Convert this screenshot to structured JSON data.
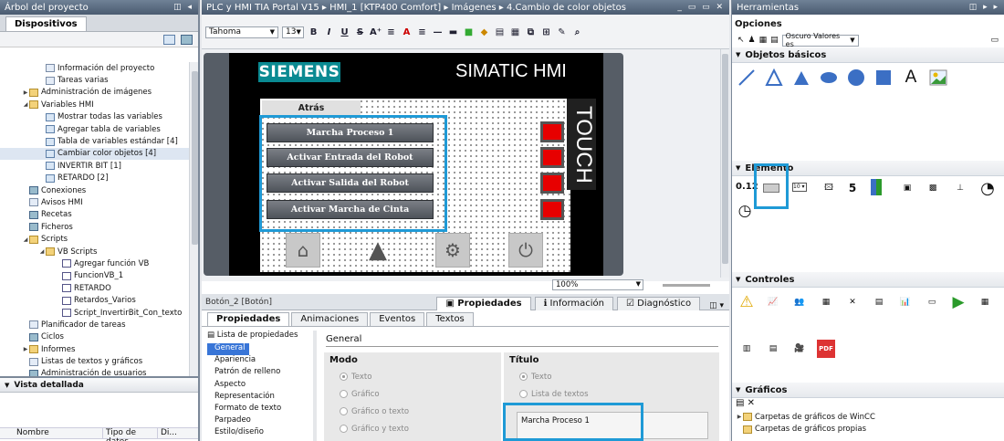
{
  "left": {
    "header": "Árbol del proyecto",
    "tab": "Dispositivos",
    "tree": [
      {
        "label": "Información del proyecto",
        "indent": 52,
        "icon": "doc"
      },
      {
        "label": "Tareas varias",
        "indent": 52,
        "icon": "doc"
      },
      {
        "label": "Administración de imágenes",
        "indent": 34,
        "icon": "folder",
        "arrow": "▶"
      },
      {
        "label": "Variables HMI",
        "indent": 34,
        "icon": "folder",
        "arrow": "◢"
      },
      {
        "label": "Mostrar todas las variables",
        "indent": 52,
        "icon": "tag"
      },
      {
        "label": "Agregar tabla de variables",
        "indent": 52,
        "icon": "tag"
      },
      {
        "label": "Tabla de variables estándar [4]",
        "indent": 52,
        "icon": "tag"
      },
      {
        "label": "Cambiar color objetos [4]",
        "indent": 52,
        "icon": "tag",
        "sel": true
      },
      {
        "label": "INVERTIR BIT [1]",
        "indent": 52,
        "icon": "tag"
      },
      {
        "label": "RETARDO [2]",
        "indent": 52,
        "icon": "tag"
      },
      {
        "label": "Conexiones",
        "indent": 34,
        "icon": "gear"
      },
      {
        "label": "Avisos HMI",
        "indent": 34,
        "icon": "doc"
      },
      {
        "label": "Recetas",
        "indent": 34,
        "icon": "gear"
      },
      {
        "label": "Ficheros",
        "indent": 34,
        "icon": "gear"
      },
      {
        "label": "Scripts",
        "indent": 34,
        "icon": "folder",
        "arrow": "◢"
      },
      {
        "label": "VB Scripts",
        "indent": 52,
        "icon": "folder",
        "arrow": "◢"
      },
      {
        "label": "Agregar función VB",
        "indent": 70,
        "icon": "script"
      },
      {
        "label": "FuncionVB_1",
        "indent": 70,
        "icon": "script"
      },
      {
        "label": "RETARDO",
        "indent": 70,
        "icon": "script"
      },
      {
        "label": "Retardos_Varios",
        "indent": 70,
        "icon": "script"
      },
      {
        "label": "Script_InvertirBit_Con_texto",
        "indent": 70,
        "icon": "script"
      },
      {
        "label": "Planificador de tareas",
        "indent": 34,
        "icon": "doc"
      },
      {
        "label": "Ciclos",
        "indent": 34,
        "icon": "gear"
      },
      {
        "label": "Informes",
        "indent": 34,
        "icon": "folder",
        "arrow": "▶"
      },
      {
        "label": "Listas de textos y gráficos",
        "indent": 34,
        "icon": "doc"
      },
      {
        "label": "Administración de usuarios",
        "indent": 34,
        "icon": "gear"
      }
    ],
    "detail_header": "Vista detallada",
    "detail_cols": [
      "Nombre",
      "Tipo de datos",
      "Di..."
    ]
  },
  "editor": {
    "breadcrumb": "PLC y HMI TIA Portal V15  ▸  HMI_1 [KTP400 Comfort]  ▸  Imágenes  ▸  4.Cambio de color objetos",
    "font": "Tahoma",
    "font_size": "13",
    "zoom": "100%",
    "hmi": {
      "brand": "SIEMENS",
      "product": "SIMATIC HMI",
      "touch": "TOUCH",
      "back": "Atrás",
      "buttons": [
        "Marcha Proceso 1",
        "Activar Entrada del Robot",
        "Activar Salida del Robot",
        "Activar Marcha de Cinta"
      ]
    }
  },
  "props": {
    "object": "Botón_2 [Botón]",
    "view_tabs": [
      "Propiedades",
      "Información",
      "Diagnóstico"
    ],
    "tabs": [
      "Propiedades",
      "Animaciones",
      "Eventos",
      "Textos"
    ],
    "list_title": "Lista de propiedades",
    "list": [
      "General",
      "Apariencia",
      "Patrón de relleno",
      "Aspecto",
      "Representación",
      "Formato de texto",
      "Parpadeo",
      "Estilo/diseño"
    ],
    "section": "General",
    "mode_title": "Modo",
    "mode_options": [
      "Texto",
      "Gráfico",
      "Gráfico o texto",
      "Gráfico y texto"
    ],
    "title_title": "Título",
    "title_options": [
      "Texto",
      "Lista de textos"
    ],
    "title_value": "Marcha Proceso 1"
  },
  "tools": {
    "header": "Herramientas",
    "options": "Opciones",
    "style": "Oscuro Valores es",
    "basic": "Objetos básicos",
    "elements": "Elemento",
    "controls": "Controles",
    "graphics": "Gráficos",
    "gfx_items": [
      "Carpetas de gráficos de WinCC",
      "Carpetas de gráficos propias"
    ],
    "io_label": "0.12"
  }
}
